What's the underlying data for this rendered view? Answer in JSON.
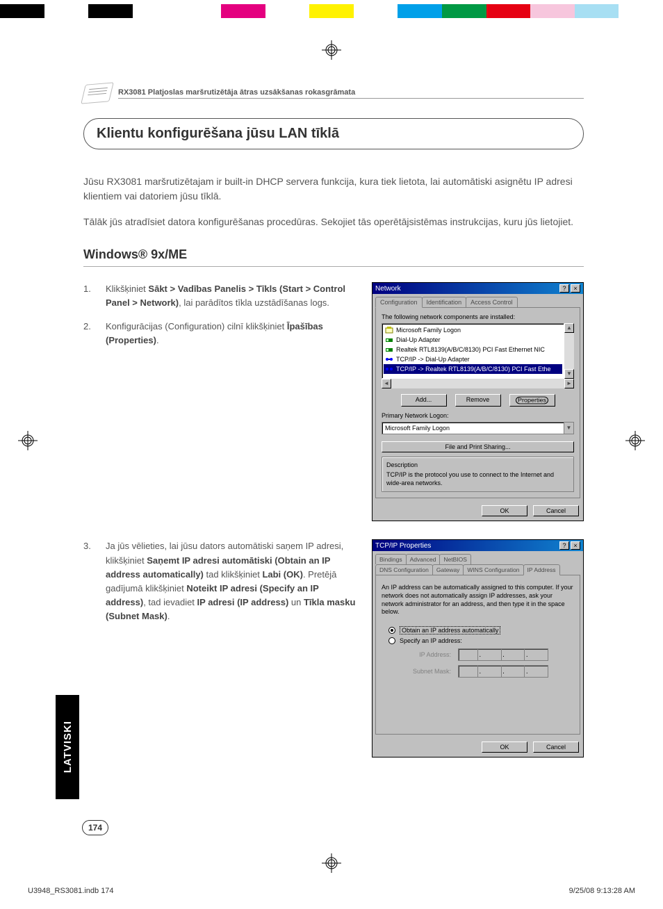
{
  "colorbar": [
    "#000",
    "#fff",
    "#000",
    "#fff",
    "#fff",
    "#e4007f",
    "#fff",
    "#fff200",
    "#fff",
    "#00a0e9",
    "#009944",
    "#e60012",
    "#f7c6dd",
    "#a7dff3",
    "#fff"
  ],
  "header": {
    "title": "RX3081 Platjoslas maršrutizētāja ātras uzsākšanas rokasgrāmata"
  },
  "section": {
    "heading": "Klientu konfigurēšana jūsu LAN tīklā"
  },
  "intro1": "Jūsu RX3081 maršrutizētajam ir built-in DHCP servera funkcija, kura tiek lietota, lai automātiski asignētu IP adresi klientiem vai datoriem jūsu tīklā.",
  "intro2": "Tālāk jūs atradīsiet datora konfigurēšanas procedūras. Sekojiet tās operētājsistēmas instrukcijas, kuru jūs lietojiet.",
  "subhead": "Windows® 9x/ME",
  "steps_a": [
    {
      "num": "1.",
      "pre": "Klikšķiniet ",
      "b1": "Sākt > Vadības Panelis > Tīkls (Start > Control Panel > Network)",
      "post": ", lai parādītos tīkla uzstādīšanas logs."
    },
    {
      "num": "2.",
      "pre": "Konfigurācijas (Configuration) cilnī klikšķiniet ",
      "b1": "Īpašības (Properties)",
      "post": "."
    }
  ],
  "step3": {
    "num": "3.",
    "pre": "Ja jūs vēlieties, lai jūsu dators automātiski saņem IP adresi, klikšķiniet ",
    "b1": "Saņemt IP adresi automātiski (Obtain an IP address automatically)",
    "mid1": " tad klikšķiniet ",
    "b2": "Labi (OK)",
    "mid2": ". Pretējā gadījumā klikšķiniet ",
    "b3": "Noteikt IP adresi (Specify an IP address)",
    "mid3": ", tad ievadiet ",
    "b4": "IP adresi (IP address)",
    "mid4": " un ",
    "b5": "Tīkla masku (Subnet Mask)",
    "post": "."
  },
  "dlg1": {
    "title": "Network",
    "tabs": [
      "Configuration",
      "Identification",
      "Access Control"
    ],
    "list_label": "The following network components are installed:",
    "items": [
      {
        "icon": "net",
        "text": "Microsoft Family Logon"
      },
      {
        "icon": "adapter",
        "text": "Dial-Up Adapter"
      },
      {
        "icon": "adapter",
        "text": "Realtek RTL8139(A/B/C/8130) PCI Fast Ethernet NIC"
      },
      {
        "icon": "proto",
        "text": "TCP/IP -> Dial-Up Adapter"
      },
      {
        "icon": "proto",
        "text": "TCP/IP -> Realtek RTL8139(A/B/C/8130) PCI Fast Ethe",
        "sel": true
      }
    ],
    "btn_add": "Add...",
    "btn_remove": "Remove",
    "btn_props": "Properties",
    "pnl_label": "Primary Network Logon:",
    "pnl_value": "Microsoft Family Logon",
    "fps": "File and Print Sharing...",
    "desc_label": "Description",
    "desc_text": "TCP/IP is the protocol you use to connect to the Internet and wide-area networks.",
    "ok": "OK",
    "cancel": "Cancel"
  },
  "dlg2": {
    "title": "TCP/IP Properties",
    "tabs_row1": [
      "Bindings",
      "Advanced",
      "NetBIOS"
    ],
    "tabs_row2": [
      "DNS Configuration",
      "Gateway",
      "WINS Configuration",
      "IP Address"
    ],
    "info": "An IP address can be automatically assigned to this computer. If your network does not automatically assign IP addresses, ask your network administrator for an address, and then type it in the space below.",
    "opt_auto": "Obtain an IP address automatically",
    "opt_spec": "Specify an IP address:",
    "ip_label": "IP Address:",
    "mask_label": "Subnet Mask:",
    "ok": "OK",
    "cancel": "Cancel"
  },
  "sidetab": "LATVISKI",
  "pagenum": "174",
  "footer_left": "U3948_RS3081.indb   174",
  "footer_right": "9/25/08   9:13:28 AM"
}
